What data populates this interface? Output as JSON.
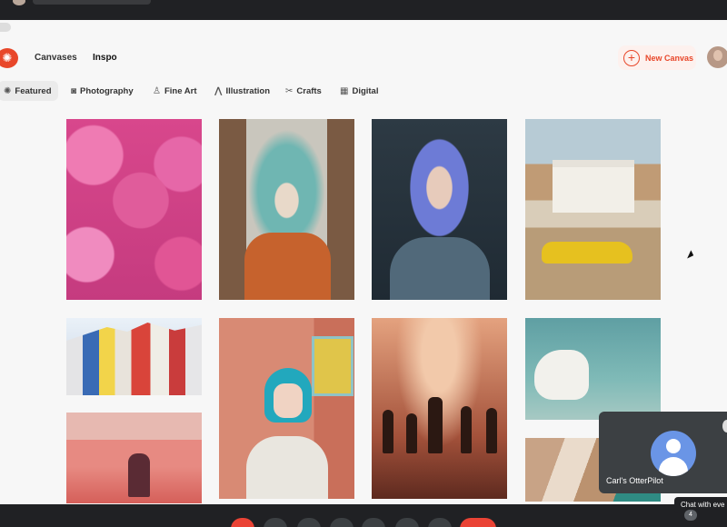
{
  "header": {
    "nav": {
      "canvases": "Canvases",
      "inspo": "Inspo"
    },
    "new_canvas": "New Canvas"
  },
  "tabs": [
    {
      "label": "Featured",
      "icon": "sparkle-icon",
      "active": true
    },
    {
      "label": "Photography",
      "icon": "camera-icon"
    },
    {
      "label": "Fine Art",
      "icon": "brush-icon"
    },
    {
      "label": "Illustration",
      "icon": "pen-icon"
    },
    {
      "label": "Crafts",
      "icon": "scissors-icon"
    },
    {
      "label": "Digital",
      "icon": "grid-icon"
    }
  ],
  "meeting": {
    "participant_name": "Carl's OtterPilot",
    "chat_tooltip": "Chat with eve",
    "people_count": "4"
  },
  "colors": {
    "brand": "#e8472a",
    "taskbar": "#202124",
    "meet_red": "#ea4335"
  }
}
